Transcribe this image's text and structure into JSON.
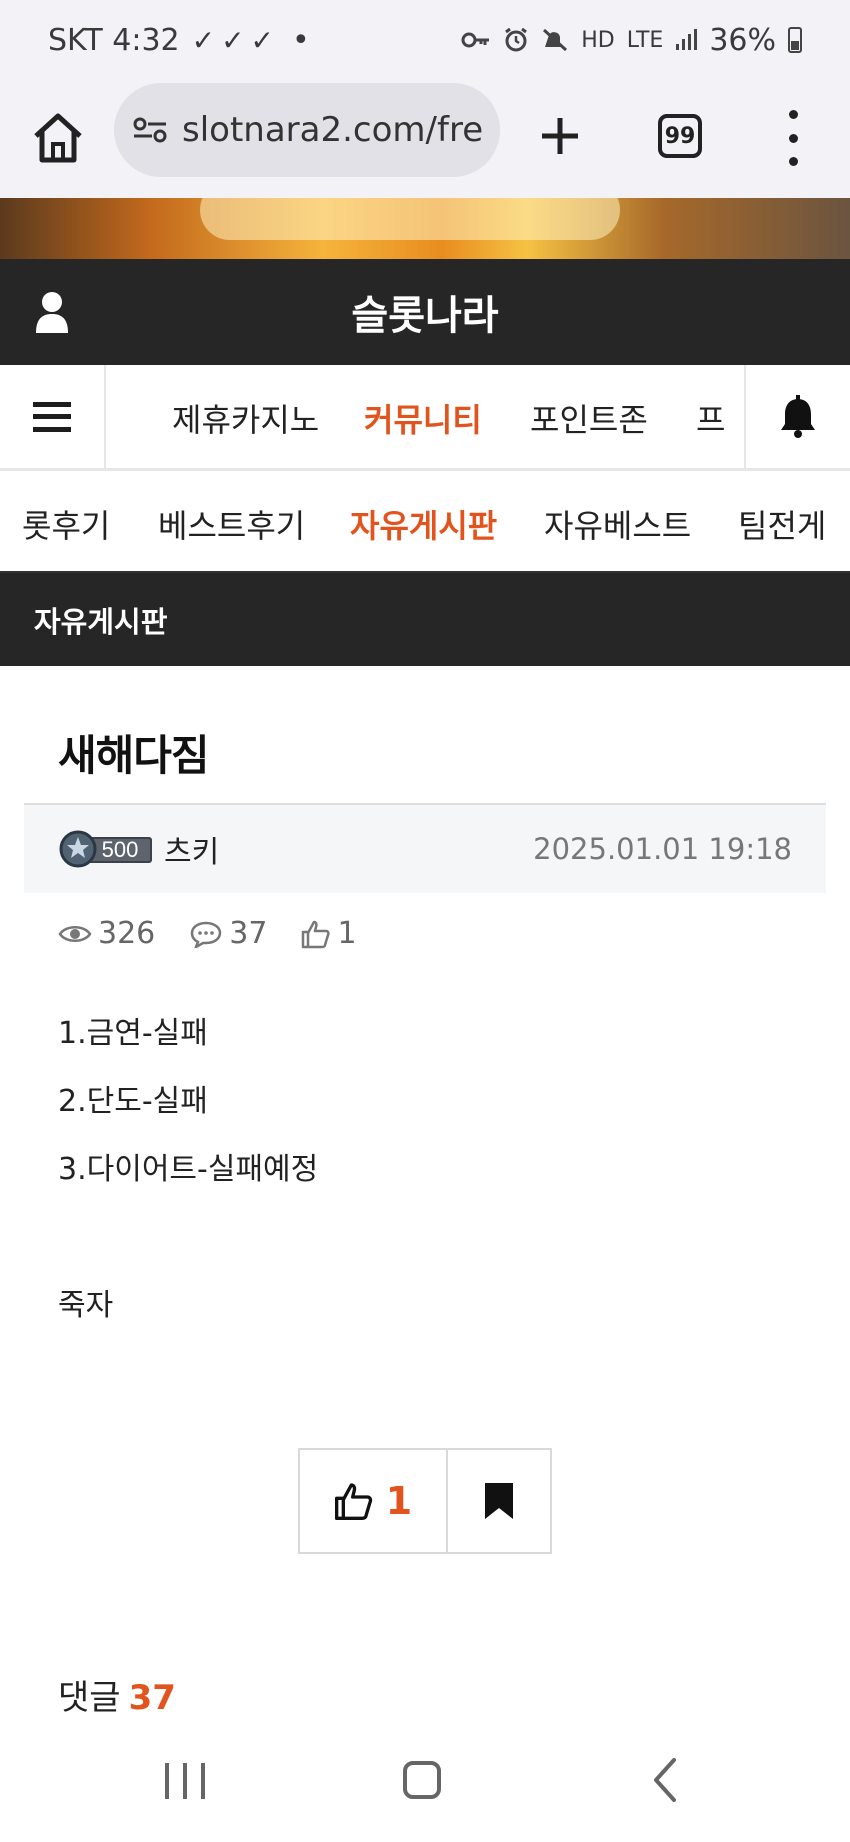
{
  "status_bar": {
    "carrier_time": "SKT 4:32",
    "checks": "✓✓✓",
    "dot": "•",
    "net_hd": "HD",
    "net_lte": "LTE",
    "battery_text": "36%"
  },
  "browser": {
    "url": "slotnara2.com/fre",
    "tab_count": "99"
  },
  "site": {
    "title": "슬롯나라"
  },
  "main_nav": {
    "items": [
      "제휴카지노",
      "커뮤니티",
      "포인트존",
      "프"
    ],
    "active_index": 1
  },
  "sub_nav": {
    "items": [
      "롯후기",
      "베스트후기",
      "자유게시판",
      "자유베스트",
      "팀전게"
    ],
    "active_index": 2
  },
  "board": {
    "title": "자유게시판"
  },
  "post": {
    "title": "새해다짐",
    "level": "500",
    "author": "츠키",
    "date": "2025.01.01 19:18",
    "views": "326",
    "comments": "37",
    "likes": "1",
    "lines": [
      "1.금연-실패",
      "2.단도-실패",
      "3.다이어트-실패예정",
      "죽자"
    ]
  },
  "actions": {
    "like_count": "1"
  },
  "comments": {
    "label": "댓글",
    "count": "37"
  },
  "colors": {
    "accent": "#e2541d",
    "header_bg": "#262626"
  }
}
